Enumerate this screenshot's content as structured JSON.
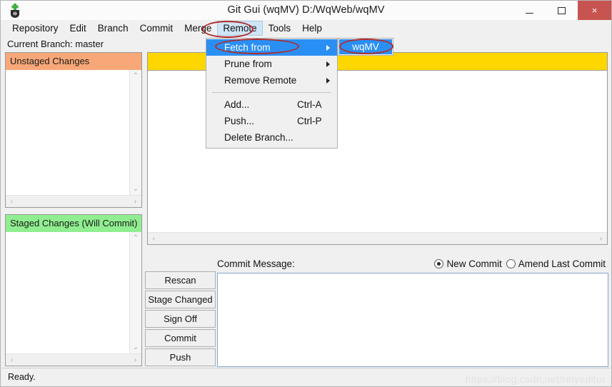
{
  "window": {
    "title": "Git Gui (wqMV) D:/WqWeb/wqMV",
    "icon": "git-gui-icon",
    "controls": {
      "minimize": "minimize-icon",
      "maximize": "maximize-icon",
      "close": "×"
    },
    "close_color": "#c75450"
  },
  "menubar": {
    "items": [
      {
        "label": "Repository",
        "active": false
      },
      {
        "label": "Edit",
        "active": false
      },
      {
        "label": "Branch",
        "active": false
      },
      {
        "label": "Commit",
        "active": false
      },
      {
        "label": "Merge",
        "active": false
      },
      {
        "label": "Remote",
        "active": true
      },
      {
        "label": "Tools",
        "active": false
      },
      {
        "label": "Help",
        "active": false
      }
    ]
  },
  "branch_bar": {
    "text": "Current Branch: master"
  },
  "dropdown": {
    "items": [
      {
        "label": "Fetch from",
        "submenu": true,
        "highlighted": true,
        "accel": ""
      },
      {
        "label": "Prune from",
        "submenu": true,
        "highlighted": false,
        "accel": ""
      },
      {
        "label": "Remove Remote",
        "submenu": true,
        "highlighted": false,
        "accel": ""
      },
      {
        "label": "Add...",
        "submenu": false,
        "highlighted": false,
        "accel": "Ctrl-A"
      },
      {
        "label": "Push...",
        "submenu": false,
        "highlighted": false,
        "accel": "Ctrl-P"
      },
      {
        "label": "Delete Branch...",
        "submenu": false,
        "highlighted": false,
        "accel": ""
      }
    ],
    "highlight_color": "#2a8ff5"
  },
  "submenu": {
    "items": [
      {
        "label": "wqMV",
        "highlighted": true
      }
    ]
  },
  "panels": {
    "unstaged": {
      "header": "Unstaged Changes",
      "color": "#f8a878",
      "items": []
    },
    "staged": {
      "header": "Staged Changes (Will Commit)",
      "color": "#90ee90",
      "items": []
    }
  },
  "diff": {
    "highlight_color": "#ffd700",
    "content": ""
  },
  "buttons": [
    {
      "label": "Rescan"
    },
    {
      "label": "Stage Changed"
    },
    {
      "label": "Sign Off"
    },
    {
      "label": "Commit"
    },
    {
      "label": "Push"
    }
  ],
  "commit": {
    "label": "Commit Message:",
    "message_value": "",
    "options": [
      {
        "label": "New Commit",
        "checked": true
      },
      {
        "label": "Amend Last Commit",
        "checked": false
      }
    ]
  },
  "statusbar": {
    "text": "Ready.",
    "watermark": "https://blog.csdn.net/relyeditor"
  },
  "scroll_icons": {
    "up": "⌃",
    "down": "⌄",
    "left": "‹",
    "right": "›"
  },
  "annotations": [
    {
      "target": "Remote"
    },
    {
      "target": "Fetch from"
    },
    {
      "target": "wqMV"
    }
  ]
}
